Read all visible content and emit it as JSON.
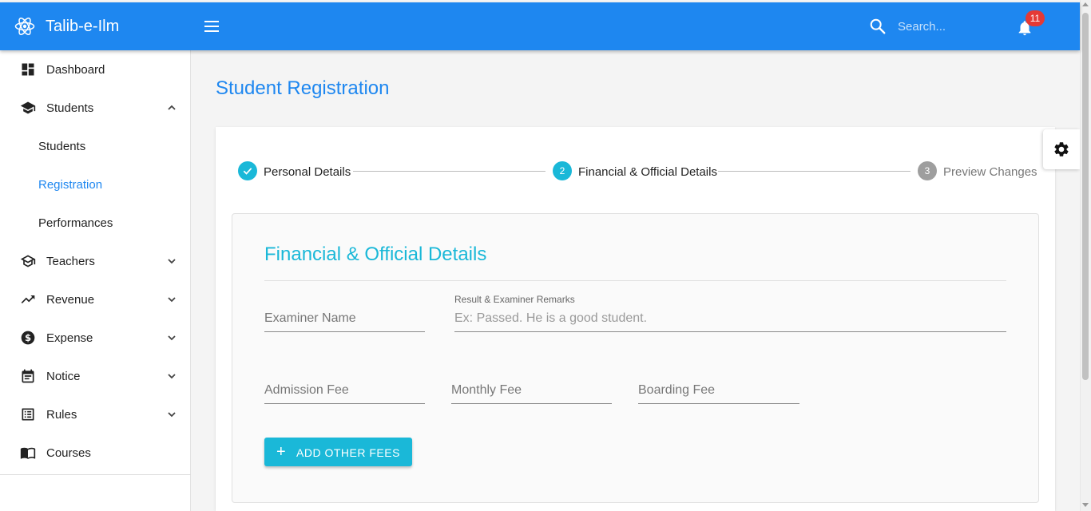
{
  "app": {
    "title": "Talib-e-Ilm",
    "accent": "#1e87f0",
    "secondary": "#1ab8d8"
  },
  "header": {
    "search_placeholder": "Search...",
    "notification_count": "11",
    "icons": {
      "logo": "react-atom-icon",
      "menu": "hamburger-icon",
      "search": "search-icon",
      "notifications": "bell-icon"
    }
  },
  "sidebar": {
    "items": [
      {
        "label": "Dashboard",
        "icon": "dashboard-icon"
      },
      {
        "label": "Students",
        "icon": "school-icon",
        "expanded": true
      },
      {
        "label": "Teachers",
        "icon": "teacher-icon"
      },
      {
        "label": "Revenue",
        "icon": "trending-up-icon"
      },
      {
        "label": "Expense",
        "icon": "dollar-icon"
      },
      {
        "label": "Notice",
        "icon": "calendar-icon"
      },
      {
        "label": "Rules",
        "icon": "list-icon"
      },
      {
        "label": "Courses",
        "icon": "book-icon"
      }
    ],
    "students_sub": [
      {
        "label": "Students",
        "active": false
      },
      {
        "label": "Registration",
        "active": true
      },
      {
        "label": "Performances",
        "active": false
      }
    ]
  },
  "main": {
    "page_title": "Student Registration",
    "stepper": [
      {
        "label": "Personal Details",
        "state": "completed",
        "number": ""
      },
      {
        "label": "Financial & Official Details",
        "state": "active",
        "number": "2"
      },
      {
        "label": "Preview Changes",
        "state": "pending",
        "number": "3"
      }
    ],
    "section_title": "Financial & Official Details",
    "form": {
      "examiner_name_placeholder": "Examiner Name",
      "remarks_label": "Result & Examiner Remarks",
      "remarks_placeholder": "Ex: Passed. He is a good student.",
      "admission_fee_placeholder": "Admission Fee",
      "monthly_fee_placeholder": "Monthly Fee",
      "boarding_fee_placeholder": "Boarding Fee",
      "add_fees_label": "ADD OTHER FEES"
    },
    "settings_icon": "gear-icon"
  }
}
